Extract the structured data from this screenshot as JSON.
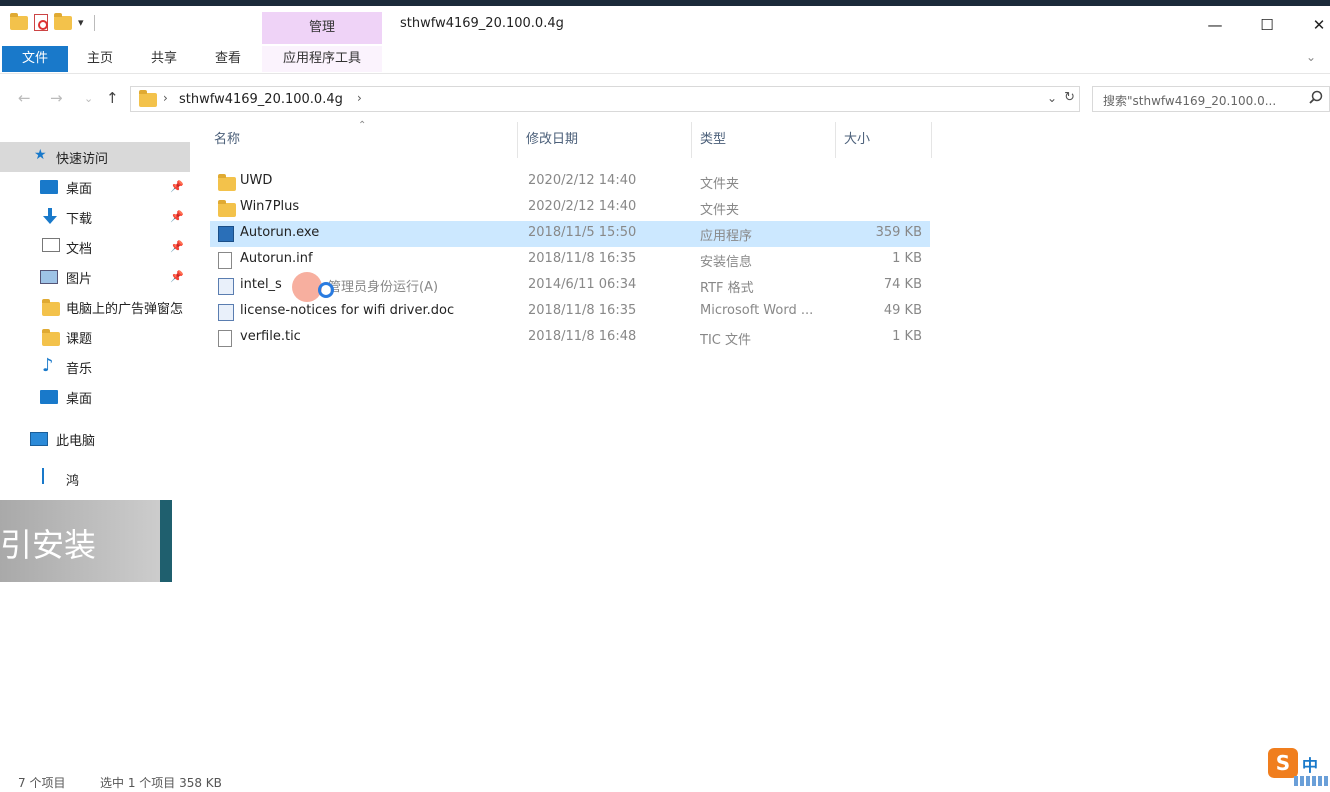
{
  "window": {
    "title": "sthwfw4169_20.100.0.4g",
    "context_tab": "管理",
    "controls": {
      "minimize": "—",
      "maximize": "☐",
      "close": "✕"
    }
  },
  "qat": {
    "dropdown": "▾"
  },
  "ribbon": {
    "tabs": [
      {
        "label": "文件"
      },
      {
        "label": "主页"
      },
      {
        "label": "共享"
      },
      {
        "label": "查看"
      },
      {
        "label": "应用程序工具"
      }
    ],
    "expand": "⌄"
  },
  "address": {
    "back": "←",
    "forward": "→",
    "recent": "⌄",
    "up": "↑",
    "sep1": "›",
    "path": "sthwfw4169_20.100.0.4g",
    "sep2": "›",
    "dropdown": "⌄",
    "refresh": "↻"
  },
  "search": {
    "placeholder": "搜索\"sthwfw4169_20.100.0...",
    "icon": "search-icon"
  },
  "sidebar": {
    "items": [
      {
        "label": "快速访问",
        "icon": "star-icon",
        "selected": true
      },
      {
        "label": "桌面",
        "icon": "desktop-icon",
        "pinned": true
      },
      {
        "label": "下载",
        "icon": "download-icon",
        "pinned": true
      },
      {
        "label": "文档",
        "icon": "documents-icon",
        "pinned": true
      },
      {
        "label": "图片",
        "icon": "pictures-icon",
        "pinned": true
      },
      {
        "label": "电脑上的广告弹窗怎",
        "icon": "folder-icon"
      },
      {
        "label": "课题",
        "icon": "folder-icon"
      },
      {
        "label": "音乐",
        "icon": "music-icon"
      },
      {
        "label": "桌面",
        "icon": "desktop-icon"
      },
      {
        "label": "此电脑",
        "icon": "computer-icon"
      }
    ],
    "pin_glyph": "📌",
    "music_glyph": "♪",
    "star_glyph": "★"
  },
  "overlay": {
    "popup_text": "鸿",
    "banner_text": "引安装"
  },
  "columns": {
    "name": "名称",
    "date": "修改日期",
    "type": "类型",
    "size": "大小",
    "sort_indicator": "⌃"
  },
  "files": [
    {
      "name": "UWD",
      "date": "2020/2/12 14:40",
      "type": "文件夹",
      "size": "",
      "icon": "folder-icon"
    },
    {
      "name": "Win7Plus",
      "date": "2020/2/12 14:40",
      "type": "文件夹",
      "size": "",
      "icon": "folder-icon"
    },
    {
      "name": "Autorun.exe",
      "date": "2018/11/5 15:50",
      "type": "应用程序",
      "size": "359 KB",
      "icon": "exe-icon",
      "selected": true
    },
    {
      "name": "Autorun.inf",
      "date": "2018/11/8 16:35",
      "type": "安装信息",
      "size": "1 KB",
      "icon": "file-icon"
    },
    {
      "name": "intel_s",
      "date": "2014/6/11 06:34",
      "type": "RTF 格式",
      "size": "74 KB",
      "icon": "wordpad-icon"
    },
    {
      "name": "license-notices for wifi driver.doc",
      "date": "2018/11/8 16:35",
      "type": "Microsoft Word ...",
      "size": "49 KB",
      "icon": "wordpad-icon"
    },
    {
      "name": "verfile.tic",
      "date": "2018/11/8 16:48",
      "type": "TIC 文件",
      "size": "1 KB",
      "icon": "file-icon"
    }
  ],
  "context_hint": "管理员身份运行(A)",
  "status": {
    "count": "7 个项目",
    "selection": "选中 1 个项目  358 KB"
  },
  "ime": {
    "logo": "S",
    "lang": "中"
  }
}
